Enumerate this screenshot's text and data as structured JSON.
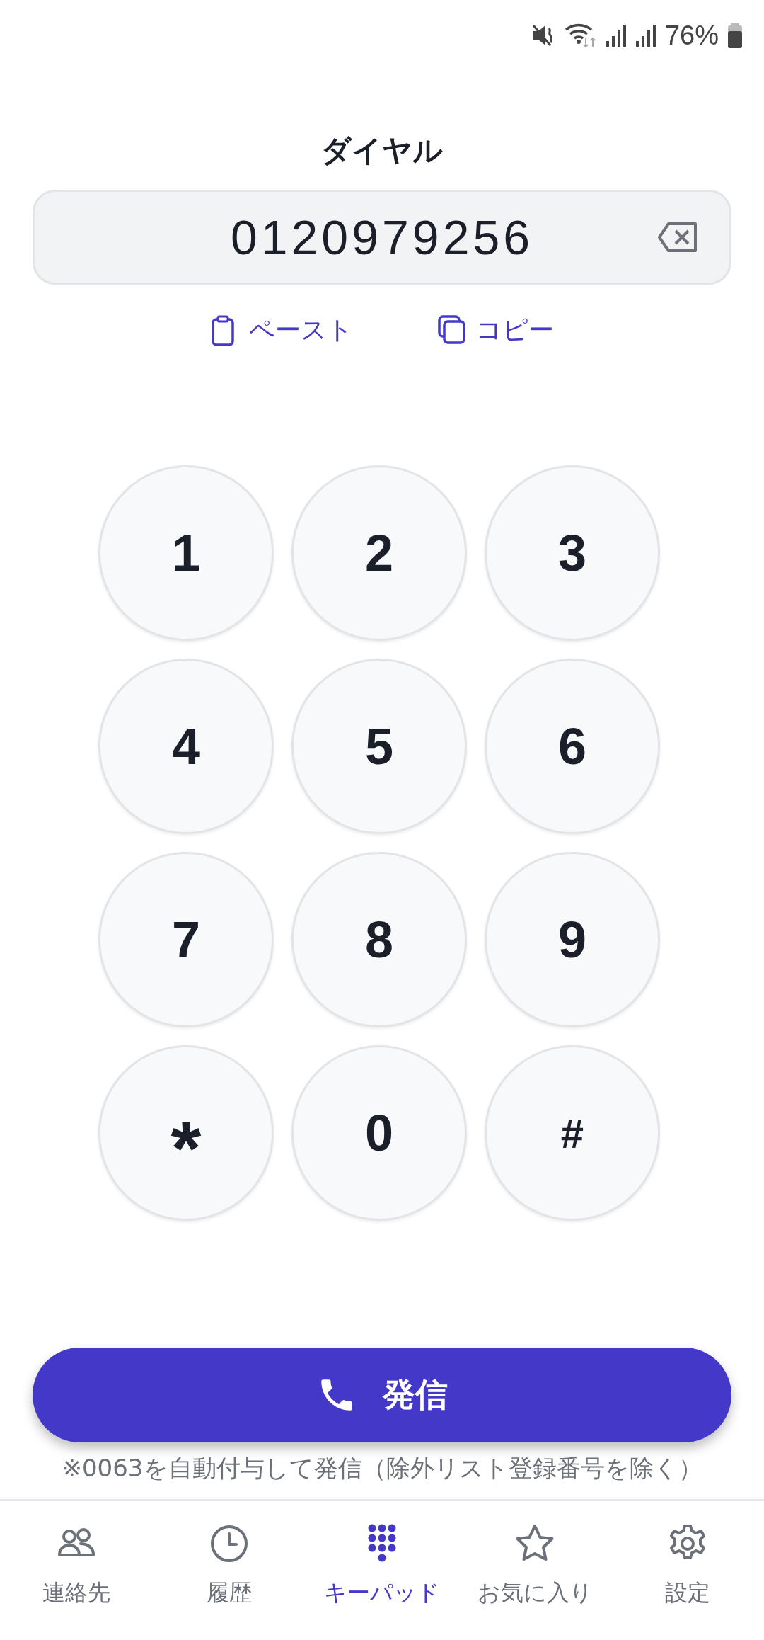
{
  "status_bar": {
    "battery": "76%"
  },
  "title": "ダイヤル",
  "number_field": {
    "value": "0120979256"
  },
  "actions": [
    {
      "kind": "paste",
      "label": "ペースト"
    },
    {
      "kind": "copy",
      "label": "コピー"
    }
  ],
  "keypad": [
    "1",
    "2",
    "3",
    "4",
    "5",
    "6",
    "7",
    "8",
    "9",
    "*",
    "0",
    "#"
  ],
  "call_button": {
    "label": "発信"
  },
  "note": "※0063を自動付与して発信（除外リスト登録番号を除く）",
  "nav": [
    {
      "kind": "contacts",
      "label": "連絡先",
      "selected": false
    },
    {
      "kind": "history",
      "label": "履歴",
      "selected": false
    },
    {
      "kind": "keypad",
      "label": "キーパッド",
      "selected": true
    },
    {
      "kind": "favorites",
      "label": "お気に入り",
      "selected": false
    },
    {
      "kind": "settings",
      "label": "設定",
      "selected": false
    }
  ]
}
